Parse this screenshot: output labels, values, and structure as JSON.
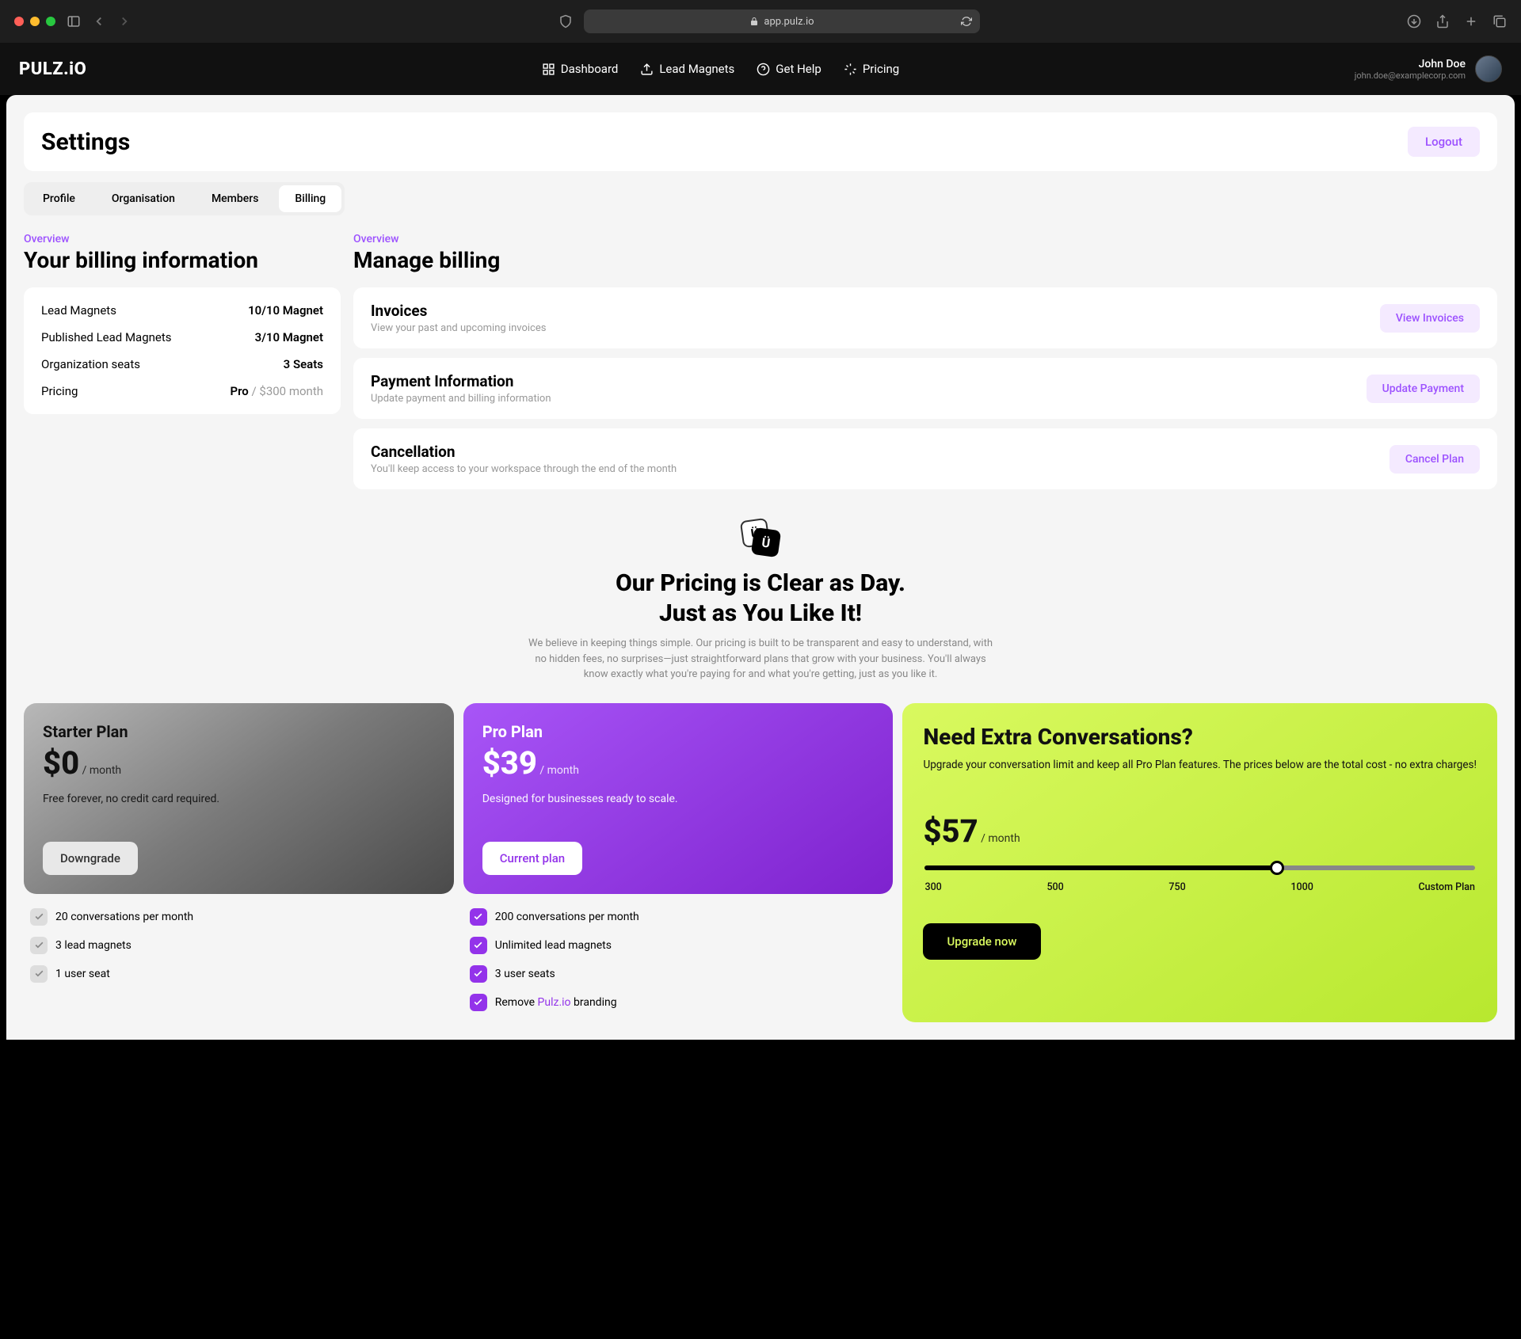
{
  "chrome": {
    "url": "app.pulz.io"
  },
  "header": {
    "logo": "PULZ.iO",
    "nav": {
      "dashboard": "Dashboard",
      "lead": "Lead Magnets",
      "help": "Get Help",
      "pricing": "Pricing"
    },
    "user_name": "John Doe",
    "user_email": "john.doe@examplecorp.com"
  },
  "page": {
    "title": "Settings",
    "logout": "Logout"
  },
  "tabs": {
    "profile": "Profile",
    "org": "Organisation",
    "members": "Members",
    "billing": "Billing"
  },
  "billing_info": {
    "overline": "Overview",
    "title": "Your billing information",
    "r1": {
      "l": "Lead Magnets",
      "v": "10/10 Magnet"
    },
    "r2": {
      "l": "Published Lead Magnets",
      "v": "3/10 Magnet"
    },
    "r3": {
      "l": "Organization seats",
      "v": "3 Seats"
    },
    "r4": {
      "l": "Pricing",
      "v": "Pro",
      "sub": " / $300 month"
    }
  },
  "manage": {
    "overline": "Overview",
    "title": "Manage billing",
    "c1": {
      "t": "Invoices",
      "d": "View your past and upcoming invoices",
      "btn": "View Invoices"
    },
    "c2": {
      "t": "Payment Information",
      "d": "Update payment and billing information",
      "btn": "Update Payment"
    },
    "c3": {
      "t": "Cancellation",
      "d": "You'll keep access to your workspace through the end of the month",
      "btn": "Cancel Plan"
    }
  },
  "hero": {
    "line1": "Our Pricing is Clear as Day.",
    "line2": "Just as You Like It!",
    "desc": "We believe in keeping things simple. Our pricing is built to be transparent and easy to understand, with no hidden fees, no surprises—just straightforward plans that grow with your business. You'll always know exactly what you're paying for and what you're getting, just as you like it."
  },
  "starter": {
    "name": "Starter Plan",
    "price": "$0",
    "period": " / month",
    "desc": "Free forever, no credit card required.",
    "btn": "Downgrade",
    "f1": "20 conversations per month",
    "f2": "3 lead magnets",
    "f3": "1 user seat"
  },
  "pro": {
    "name": "Pro Plan",
    "price": "$39",
    "period": " / month",
    "desc": "Designed for businesses ready to scale.",
    "btn": "Current plan",
    "f1": "200 conversations per month",
    "f2": "Unlimited lead magnets",
    "f3": "3 user seats",
    "f4a": "Remove ",
    "f4b": "Pulz.io",
    "f4c": " branding"
  },
  "extra": {
    "title": "Need Extra Conversations?",
    "desc": "Upgrade your conversation limit and keep all Pro Plan features. The prices below are the total cost - no extra charges!",
    "price": "$57",
    "period": " / month",
    "t1": "300",
    "t2": "500",
    "t3": "750",
    "t4": "1000",
    "t5": "Custom Plan",
    "btn": "Upgrade now"
  }
}
